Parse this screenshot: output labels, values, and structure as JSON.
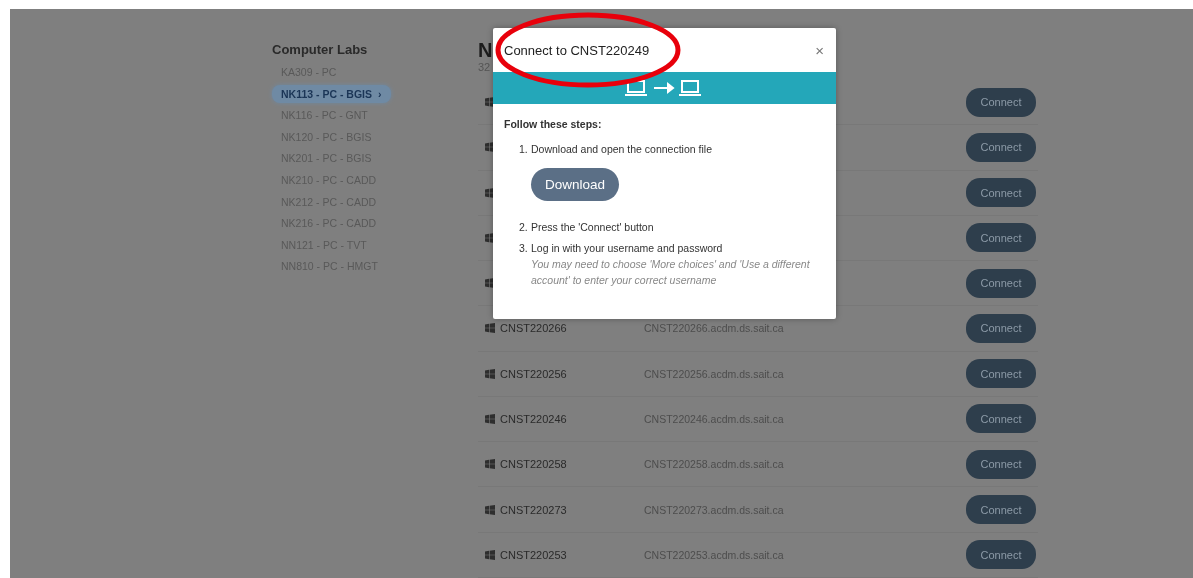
{
  "sidebar": {
    "title": "Computer Labs",
    "items": [
      {
        "label": "KA309 - PC",
        "selected": false
      },
      {
        "label": "NK113 - PC - BGIS",
        "selected": true,
        "chevron": "›"
      },
      {
        "label": "NK116 - PC - GNT",
        "selected": false
      },
      {
        "label": "NK120 - PC - BGIS",
        "selected": false
      },
      {
        "label": "NK201 - PC - BGIS",
        "selected": false
      },
      {
        "label": "NK210 - PC - CADD",
        "selected": false
      },
      {
        "label": "NK212 - PC - CADD",
        "selected": false
      },
      {
        "label": "NK216 - PC - CADD",
        "selected": false
      },
      {
        "label": "NN121 - PC - TVT",
        "selected": false
      },
      {
        "label": "NN810 - PC - HMGT",
        "selected": false
      }
    ]
  },
  "main": {
    "heading": "N",
    "subheading": "32",
    "rows": [
      {
        "button": "Connect"
      },
      {
        "button": "Connect"
      },
      {
        "button": "Connect"
      },
      {
        "button": "Connect"
      },
      {
        "button": "Connect"
      },
      {
        "name": "CNST220266",
        "host": "CNST220266.acdm.ds.sait.ca",
        "button": "Connect"
      },
      {
        "name": "CNST220256",
        "host": "CNST220256.acdm.ds.sait.ca",
        "button": "Connect"
      },
      {
        "name": "CNST220246",
        "host": "CNST220246.acdm.ds.sait.ca",
        "button": "Connect"
      },
      {
        "name": "CNST220258",
        "host": "CNST220258.acdm.ds.sait.ca",
        "button": "Connect"
      },
      {
        "name": "CNST220273",
        "host": "CNST220273.acdm.ds.sait.ca",
        "button": "Connect"
      },
      {
        "name": "CNST220253",
        "host": "CNST220253.acdm.ds.sait.ca",
        "button": "Connect"
      }
    ]
  },
  "dialog": {
    "title": "Connect to CNST220249",
    "close": "×",
    "intro": "Follow these steps:",
    "steps": [
      {
        "number": "1.",
        "text": "Download and open the connection file",
        "button": "Download"
      },
      {
        "number": "2.",
        "text": "Press the 'Connect' button"
      },
      {
        "number": "3.",
        "text": "Log in with your username and password",
        "note": "You may need to choose 'More choices' and 'Use a different account' to enter your correct username"
      }
    ]
  },
  "annotation": {
    "kind": "ellipse",
    "color": "#e8000b"
  }
}
